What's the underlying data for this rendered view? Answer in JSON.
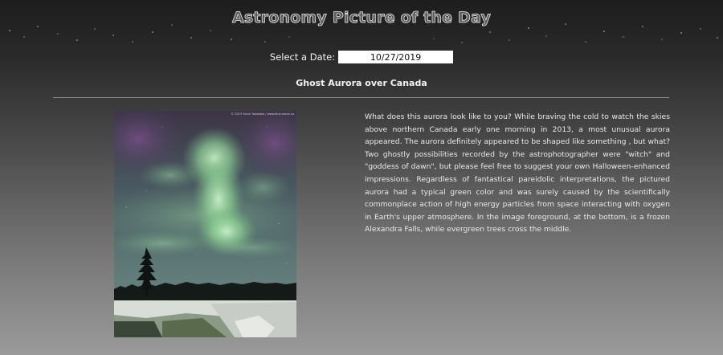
{
  "page": {
    "title": "Astronomy Picture of the Day"
  },
  "date_picker": {
    "label": "Select a Date:",
    "value": "10/27/2019"
  },
  "apod": {
    "title": "Ghost Aurora over Canada",
    "image_credit": "© 2013 Yuichi Takasaka / www.blue-moon.ca",
    "explanation": "What does this aurora look like to you? While braving the cold to watch the skies above northern Canada early one morning in 2013, a most unusual aurora appeared. The aurora definitely appeared to be shaped like something , but what? Two ghostly possibilities recorded by the astrophotographer were \"witch\" and \"goddess of dawn\", but please feel free to suggest your own Halloween-enhanced impressions. Regardless of fantastical pareidolic interpretations, the pictured aurora had a typical green color and was surely caused by the scientifically commonplace action of high energy particles from space interacting with oxygen in Earth's upper atmosphere. In the image foreground, at the bottom, is a frozen Alexandra Falls, while evergreen trees cross the middle."
  }
}
